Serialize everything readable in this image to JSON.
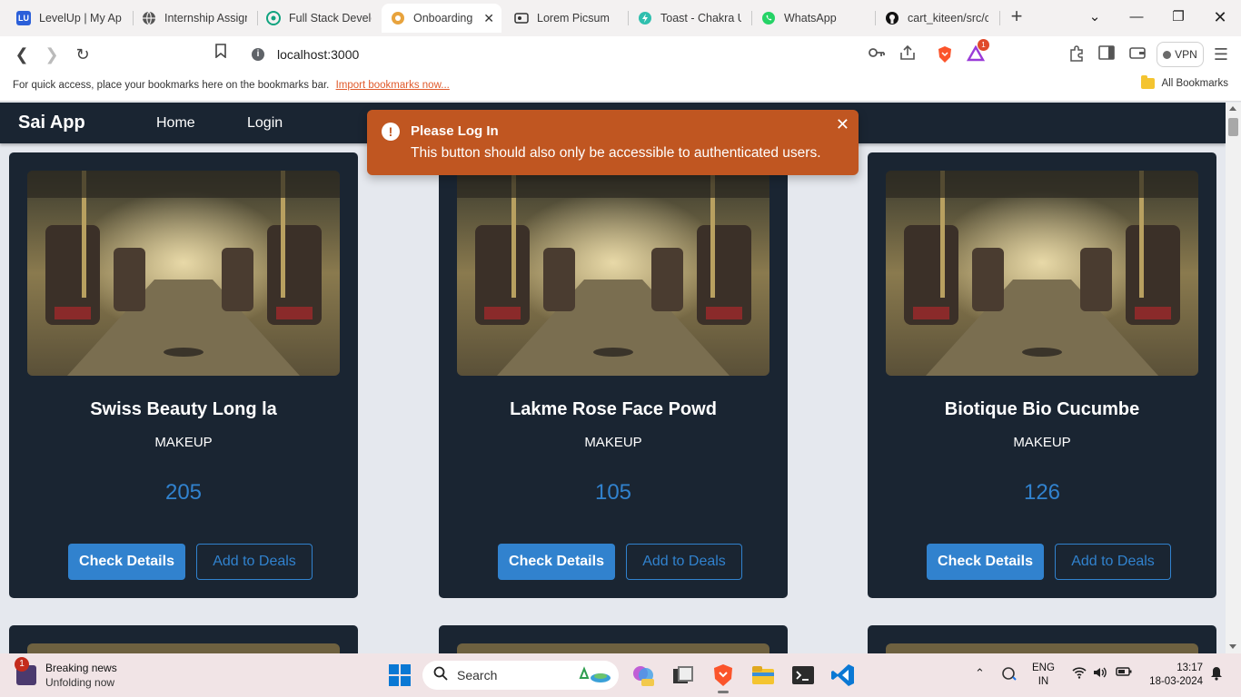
{
  "browser": {
    "tabs": [
      {
        "label": "LevelUp | My App",
        "favicon": "levelup-icon",
        "badge": "LU",
        "color": "#2b5fd9"
      },
      {
        "label": "Internship Assignment",
        "favicon": "globe-icon",
        "color": "#555555"
      },
      {
        "label": "Full Stack Developer",
        "favicon": "chatgpt-icon",
        "color": "#10a37f"
      },
      {
        "label": "Onboarding",
        "favicon": "onboarding-icon",
        "color": "#e8a33d",
        "active": true
      },
      {
        "label": "Lorem Picsum",
        "favicon": "image-icon",
        "color": "#333333"
      },
      {
        "label": "Toast - Chakra UI",
        "favicon": "chakra-icon",
        "color": "#2fbfae"
      },
      {
        "label": "WhatsApp",
        "favicon": "whatsapp-icon",
        "color": "#25d366"
      },
      {
        "label": "cart_kiteen/src/co",
        "favicon": "github-icon",
        "color": "#111111"
      }
    ],
    "url": "localhost:3000",
    "vpn_label": "VPN",
    "brave_alert_count": "1",
    "bookmarks_message": "For quick access, place your bookmarks here on the bookmarks bar.",
    "bookmarks_import": "Import bookmarks now...",
    "all_bookmarks": "All Bookmarks"
  },
  "app": {
    "brand": "Sai App",
    "nav": [
      "Home",
      "Login"
    ],
    "products": [
      {
        "title": "Swiss Beauty Long la",
        "category": "MAKEUP",
        "price": "205"
      },
      {
        "title": "Lakme Rose Face Powd",
        "category": "MAKEUP",
        "price": "105"
      },
      {
        "title": "Biotique Bio Cucumbe",
        "category": "MAKEUP",
        "price": "126"
      }
    ],
    "buttons": {
      "details": "Check Details",
      "deals": "Add to Deals"
    }
  },
  "toast": {
    "title": "Please Log In",
    "description": "This button should also only be accessible to authenticated users.",
    "status_color": "#c05621"
  },
  "taskbar": {
    "news_title": "Breaking news",
    "news_sub": "Unfolding now",
    "news_badge": "1",
    "search_label": "Search",
    "lang_top": "ENG",
    "lang_bottom": "IN",
    "time": "13:17",
    "date": "18-03-2024"
  }
}
